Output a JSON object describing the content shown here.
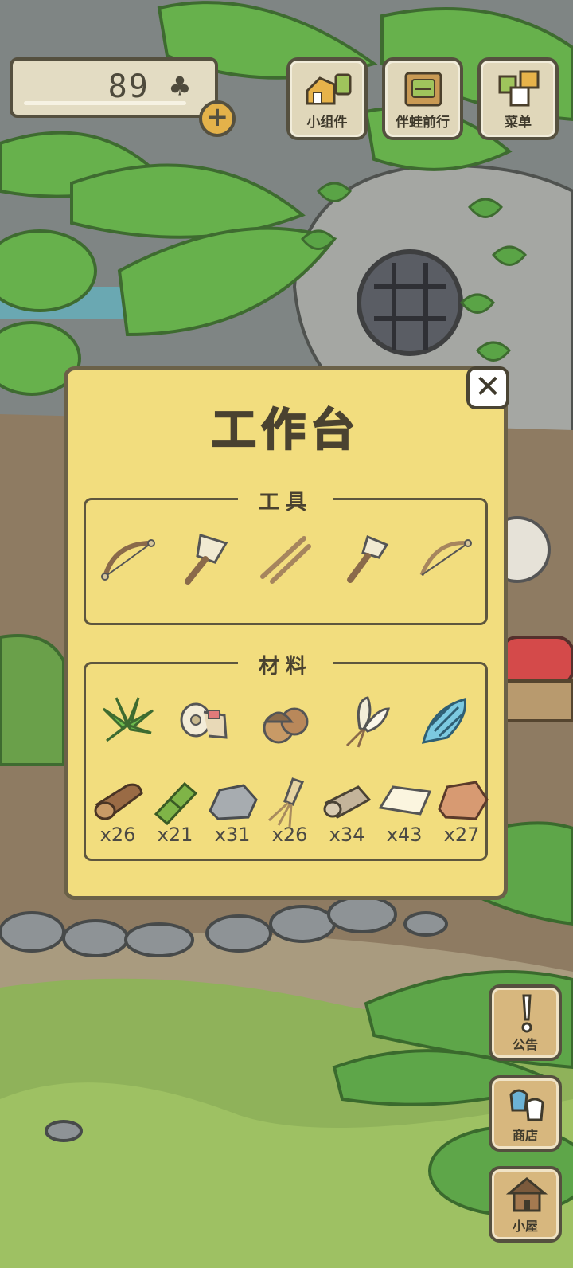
{
  "currency": {
    "amount": "89",
    "icon": "clover-icon"
  },
  "top_buttons": [
    {
      "label": "小组件",
      "icon": "widget-icon"
    },
    {
      "label": "伴蛙前行",
      "icon": "frog-companion-icon"
    },
    {
      "label": "菜单",
      "icon": "menu-icon"
    }
  ],
  "side_buttons": [
    {
      "label": "公告",
      "icon": "exclamation-icon"
    },
    {
      "label": "商店",
      "icon": "shop-bag-icon"
    },
    {
      "label": "小屋",
      "icon": "house-icon"
    }
  ],
  "workbench": {
    "title": "工作台",
    "tools_title": "工具",
    "tools": [
      {
        "icon": "bow-saw-icon"
      },
      {
        "icon": "brush-icon"
      },
      {
        "icon": "sticks-icon"
      },
      {
        "icon": "small-brush-icon"
      },
      {
        "icon": "bow-drill-icon"
      }
    ],
    "materials_title": "材料",
    "special_materials": [
      {
        "icon": "palm-leaf-icon"
      },
      {
        "icon": "paper-roll-icon"
      },
      {
        "icon": "acorns-icon"
      },
      {
        "icon": "feather-bundle-icon"
      },
      {
        "icon": "seashell-icon"
      }
    ],
    "materials": [
      {
        "icon": "log-icon",
        "count": "x26"
      },
      {
        "icon": "bamboo-icon",
        "count": "x21"
      },
      {
        "icon": "stone-icon",
        "count": "x31"
      },
      {
        "icon": "straw-bundle-icon",
        "count": "x26"
      },
      {
        "icon": "cloth-roll-icon",
        "count": "x34"
      },
      {
        "icon": "paper-sheet-icon",
        "count": "x43"
      },
      {
        "icon": "clay-icon",
        "count": "x27"
      }
    ]
  },
  "colors": {
    "panel": "#f2dd7e",
    "panel_border": "#6b6148",
    "button_bg": "#e0d7ba",
    "side_button_bg": "#d7b77e",
    "foliage": "#5fa84a"
  }
}
